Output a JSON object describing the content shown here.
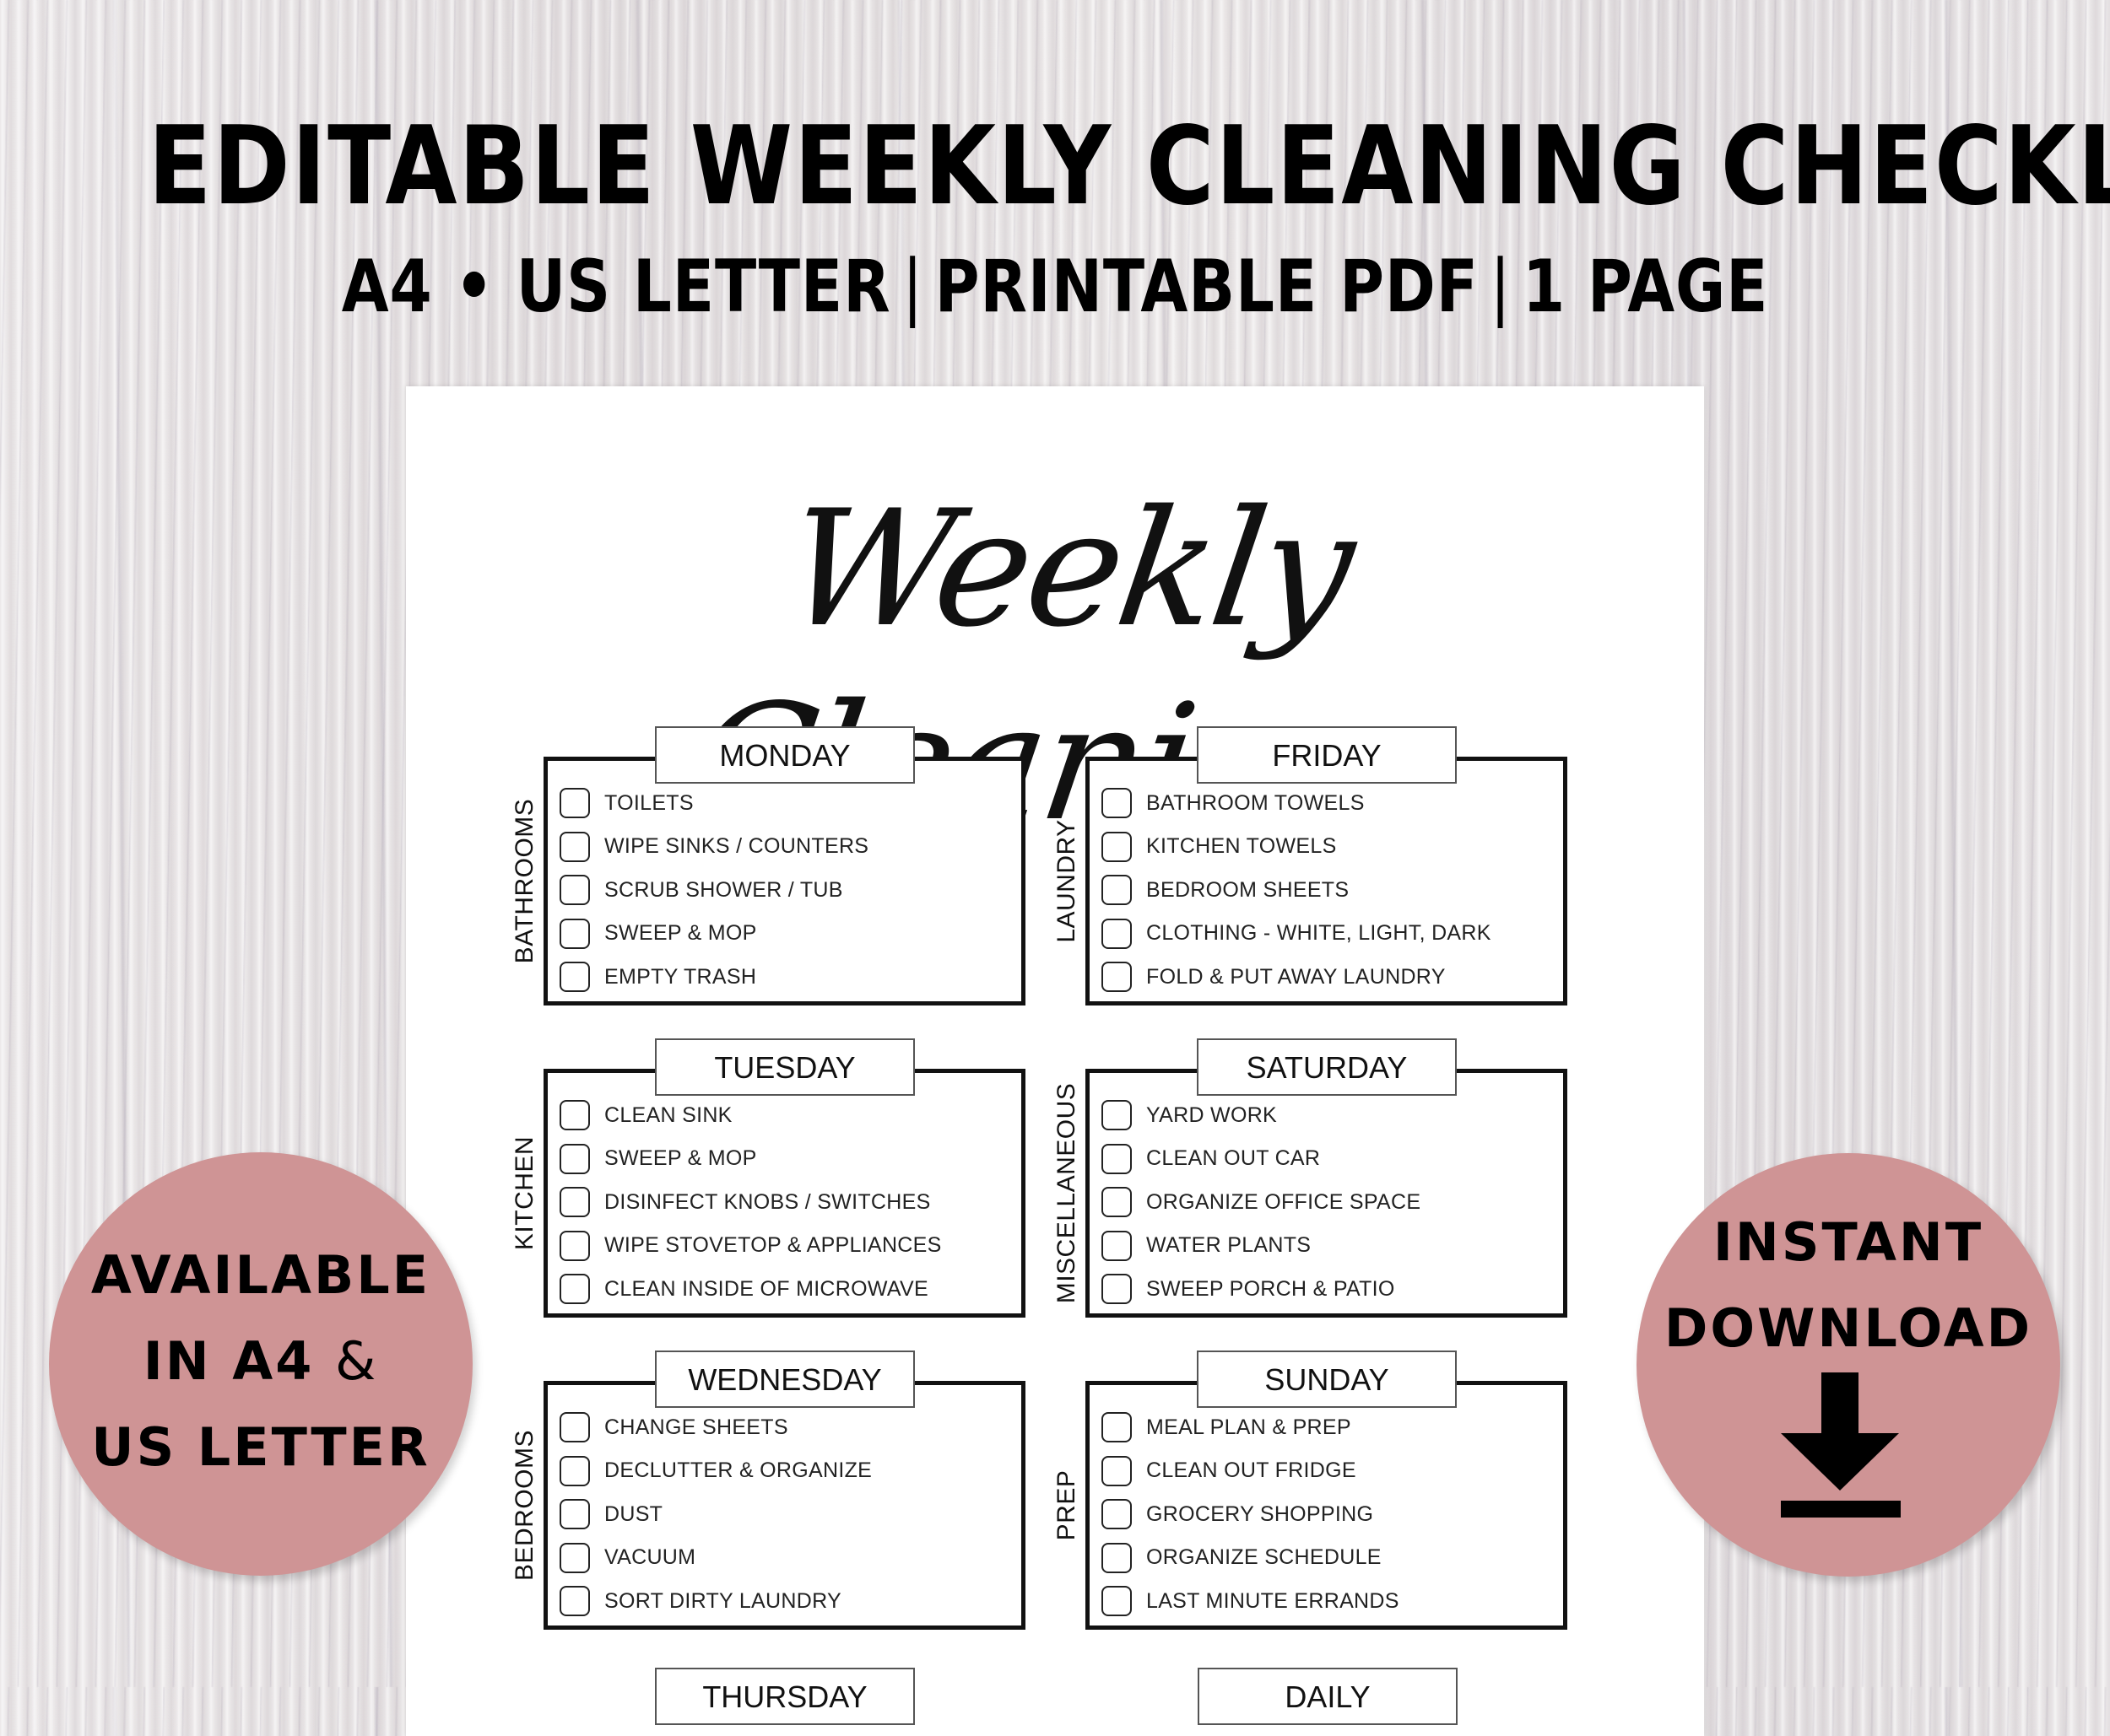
{
  "banner": {
    "headline": "EDITABLE WEEKLY CLEANING CHECKLIST",
    "subline_parts": [
      "A4 • US LETTER",
      "|",
      "PRINTABLE PDF",
      "|",
      "1 PAGE"
    ]
  },
  "colors": {
    "badge": "#cf9495",
    "background_wood": "#e9e6e7",
    "paper": "#ffffff",
    "ink": "#111111"
  },
  "document": {
    "title": "Weekly Cleaning",
    "days": [
      {
        "day": "MONDAY",
        "section": "BATHROOMS",
        "tasks": [
          "TOILETS",
          "WIPE SINKS / COUNTERS",
          "SCRUB SHOWER / TUB",
          "SWEEP & MOP",
          "EMPTY TRASH"
        ]
      },
      {
        "day": "FRIDAY",
        "section": "LAUNDRY",
        "tasks": [
          "BATHROOM TOWELS",
          "KITCHEN TOWELS",
          "BEDROOM SHEETS",
          "CLOTHING - WHITE, LIGHT, DARK",
          "FOLD & PUT AWAY LAUNDRY"
        ]
      },
      {
        "day": "TUESDAY",
        "section": "KITCHEN",
        "tasks": [
          "CLEAN SINK",
          "SWEEP & MOP",
          "DISINFECT KNOBS / SWITCHES",
          "WIPE STOVETOP & APPLIANCES",
          "CLEAN INSIDE OF MICROWAVE"
        ]
      },
      {
        "day": "SATURDAY",
        "section": "MISCELLANEOUS",
        "tasks": [
          "YARD WORK",
          "CLEAN OUT CAR",
          "ORGANIZE OFFICE SPACE",
          "WATER PLANTS",
          "SWEEP PORCH & PATIO"
        ]
      },
      {
        "day": "WEDNESDAY",
        "section": "BEDROOMS",
        "tasks": [
          "CHANGE SHEETS",
          "DECLUTTER & ORGANIZE",
          "DUST",
          "VACUUM",
          "SORT DIRTY LAUNDRY"
        ]
      },
      {
        "day": "SUNDAY",
        "section": "PREP",
        "tasks": [
          "MEAL PLAN & PREP",
          "CLEAN OUT FRIDGE",
          "GROCERY SHOPPING",
          "ORGANIZE SCHEDULE",
          "LAST MINUTE ERRANDS"
        ]
      }
    ],
    "cut_off_tabs": [
      "THURSDAY",
      "DAILY"
    ]
  },
  "badges": {
    "left": {
      "lines": [
        "AVAILABLE",
        "IN A4",
        "&",
        "US LETTER"
      ]
    },
    "right": {
      "lines": [
        "INSTANT",
        "DOWNLOAD"
      ],
      "icon": "download-arrow-icon"
    }
  }
}
